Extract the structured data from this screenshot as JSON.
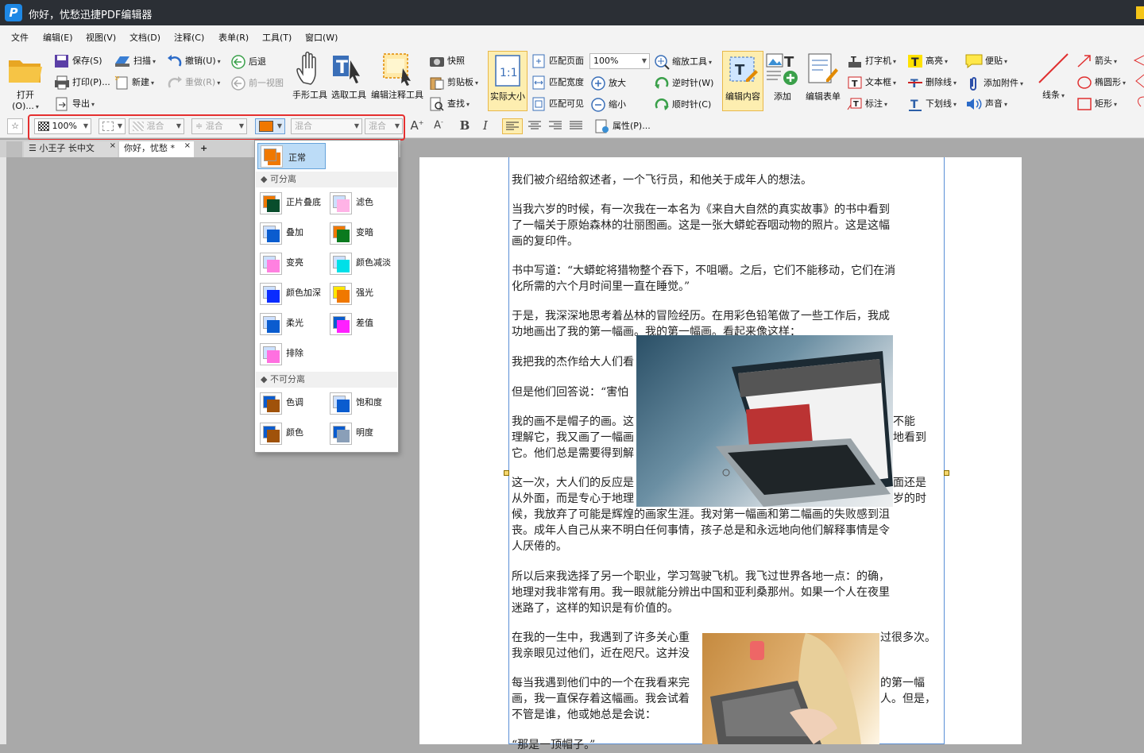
{
  "titlebar": {
    "title": "你好，忧愁迅捷PDF编辑器",
    "logo": "P"
  },
  "menu": [
    "文件",
    "编辑(E)",
    "视图(V)",
    "文档(D)",
    "注释(C)",
    "表单(R)",
    "工具(T)",
    "窗口(W)"
  ],
  "ribbon": {
    "open": "打开(O)...",
    "save": "保存(S)",
    "print": "打印(P)...",
    "export": "导出",
    "scan": "扫描",
    "new": "新建",
    "undo": "撤销(U)",
    "redo": "重做(R)",
    "back": "后退",
    "prev_view": "前一视图",
    "hand": "手形工具",
    "select": "选取工具",
    "edit_annot": "编辑注释工具",
    "snapshot": "快照",
    "clipboard": "剪贴板",
    "find": "查找",
    "actual_size": "实际大小",
    "fit_page": "匹配页面",
    "fit_width": "匹配宽度",
    "fit_visible": "匹配可见",
    "zoom_value": "100%",
    "zoom_tool": "缩放工具",
    "zoom_in": "放大",
    "zoom_out": "缩小",
    "ccw": "逆时针(W)",
    "cw": "顺时针(C)",
    "edit_content": "编辑内容",
    "add": "添加",
    "edit_form": "编辑表单",
    "typewriter": "打字机",
    "textbox": "文本框",
    "callout": "标注",
    "highlight": "高亮",
    "strikethrough": "删除线",
    "underline": "下划线",
    "note": "便贴",
    "attach": "添加附件",
    "sound": "声音",
    "line": "线条",
    "arrow": "箭头",
    "ellipse": "椭圆形",
    "rect": "矩形"
  },
  "format": {
    "opacity": "100%",
    "blend1": "混合",
    "blend2": "混合",
    "blend3": "混合",
    "blend4": "混合",
    "bold": "B",
    "italic": "I",
    "properties": "属性(P)...",
    "accent_color": "#f07800"
  },
  "tabs": [
    "小王子 长中文",
    "你好，忧愁 *"
  ],
  "blend_menu": {
    "selected": "正常",
    "section1": "可分离",
    "section2": "不可分离",
    "items1": [
      "正片叠底",
      "滤色",
      "叠加",
      "变暗",
      "变亮",
      "颜色减淡",
      "颜色加深",
      "强光",
      "柔光",
      "差值",
      "排除"
    ],
    "items2": [
      "色调",
      "饱和度",
      "颜色",
      "明度"
    ]
  },
  "doc": {
    "p1": "我们被介绍给叙述者，一个飞行员，和他关于成年人的想法。",
    "p2a": "当我六岁的时候，有一次我在一本名为《来自大自然的真实故事》的书中看到",
    "p2b": "了一幅关于原始森林的壮丽图画。这是一张大蟒蛇吞咽动物的照片。这是这幅",
    "p2c": "画的复印件。",
    "p3a": "书中写道：“大蟒蛇将猎物整个吞下，不咀嚼。之后，它们不能移动，它们在消",
    "p3b": "化所需的六个月时间里一直在睡觉。”",
    "p4a": "于是，我深深地思考着丛林的冒险经历。在用彩色铅笔做了一些工作后，我成",
    "p4b": "功地画出了我的第一幅画。我的第一幅画。看起来像这样：",
    "p5": "我把我的杰作给大人们看",
    "p6": "但是他们回答说：“害怕",
    "p7a": "我的画不是帽子的画。这",
    "p7a2": "不能",
    "p7b": "理解它，我又画了一幅画",
    "p7b2": "地看到",
    "p7c": "它。他们总是需要得到解",
    "p8a": "这一次，大人们的反应是",
    "p8a2": "面还是",
    "p8b": "从外面，而是专心于地理",
    "p8b2": "岁的时",
    "p8c": "候，我放弃了可能是辉煌的画家生涯。我对第一幅画和第二幅画的失败感到沮",
    "p8d": "丧。成年人自己从来不明白任何事情，孩子总是和永远地向他们解释事情是令",
    "p8e": "人厌倦的。",
    "p9a": "所以后来我选择了另一个职业，学习驾驶飞机。我飞过世界各地一点：的确，",
    "p9b": "地理对我非常有用。我一眼就能分辨出中国和亚利桑那州。如果一个人在夜里",
    "p9c": "迷路了，这样的知识是有价值的。",
    "p10a": "在我的一生中，我遇到了许多关心重",
    "p10a2": "过很多次。",
    "p10b": "我亲眼见过他们，近在咫尺。这并没",
    "p11a": "每当我遇到他们中的一个在我看来完",
    "p11a2": "的第一幅",
    "p11b": "画，我一直保存着这幅画。我会试着",
    "p11b2": "人。但是，",
    "p11c": "不管是谁，他或她总是会说：",
    "p12": "“那是一顶帽子。”"
  }
}
